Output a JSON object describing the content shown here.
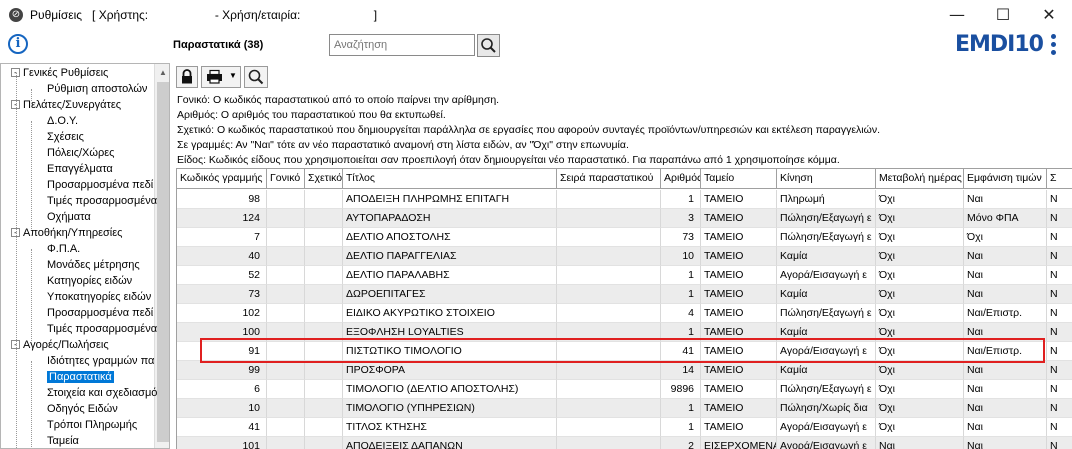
{
  "window": {
    "title": "Ρυθμίσεις   [ Χρήστης:                    - Χρήση/εταιρία:                      ]",
    "minimize_glyph": "—",
    "maximize_glyph": "☐",
    "close_glyph": "✕"
  },
  "header": {
    "page_title": "Παραστατικά (38)",
    "search_placeholder": "Αναζήτηση",
    "logo_prefix": "EMDI",
    "logo_suffix": "10"
  },
  "sidebar": {
    "items": [
      {
        "label": "Γενικές Ρυθμίσεις",
        "level": 0,
        "expander": "-"
      },
      {
        "label": "Ρύθμιση αποστολών",
        "level": 1
      },
      {
        "label": "Πελάτες/Συνεργάτες",
        "level": 0,
        "expander": "-"
      },
      {
        "label": "Δ.Ο.Υ.",
        "level": 1
      },
      {
        "label": "Σχέσεις",
        "level": 1
      },
      {
        "label": "Πόλεις/Χώρες",
        "level": 1
      },
      {
        "label": "Επαγγέλματα",
        "level": 1
      },
      {
        "label": "Προσαρμοσμένα πεδί",
        "level": 1
      },
      {
        "label": "Τιμές προσαρμοσμένα",
        "level": 1
      },
      {
        "label": "Οχήματα",
        "level": 1
      },
      {
        "label": "Αποθήκη/Υπηρεσίες",
        "level": 0,
        "expander": "-"
      },
      {
        "label": "Φ.Π.Α.",
        "level": 1
      },
      {
        "label": "Μονάδες μέτρησης",
        "level": 1
      },
      {
        "label": "Κατηγορίες ειδών",
        "level": 1
      },
      {
        "label": "Υποκατηγορίες ειδών",
        "level": 1
      },
      {
        "label": "Προσαρμοσμένα πεδί",
        "level": 1
      },
      {
        "label": "Τιμές προσαρμοσμένα",
        "level": 1
      },
      {
        "label": "Αγορές/Πωλήσεις",
        "level": 0,
        "expander": "-"
      },
      {
        "label": "Ιδιότητες γραμμών πα",
        "level": 1
      },
      {
        "label": "Παραστατικά",
        "level": 1,
        "selected": true
      },
      {
        "label": "Στοιχεία και σχεδιασμό",
        "level": 1
      },
      {
        "label": "Οδηγός Ειδών",
        "level": 1
      },
      {
        "label": "Τρόποι Πληρωμής",
        "level": 1
      },
      {
        "label": "Ταμεία",
        "level": 1
      }
    ]
  },
  "descriptions": [
    "Γονικό: Ο κωδικός παραστατικού από το οποίο παίρνει την αρίθμηση.",
    "Αριθμός: Ο αριθμός του παραστατικού που θα εκτυπωθεί.",
    "Σχετικό: Ο κωδικός παραστατικού που δημιουργείται παράλληλα σε εργασίες που αφορούν συνταγές προϊόντων/υπηρεσιών και εκτέλεση παραγγελιών.",
    "Σε γραμμές: Αν \"Ναι\" τότε αν νέο παραστατικό αναμονή στη λίστα ειδών, αν \"Όχι\" στην επωνυμία.",
    "Είδος: Κωδικός είδους που χρησιμοποιείται σαν προεπιλογή όταν δημιουργείται νέο παραστατικό. Για παραπάνω από 1 χρησιμοποίησε κόμμα."
  ],
  "grid": {
    "columns": [
      "Κωδικός γραμμής",
      "Γονικό",
      "Σχετικό",
      "Τίτλος",
      "Σειρά παραστατικού",
      "Αριθμός",
      "Ταμείο",
      "Κίνηση",
      "Μεταβολή ημέρας",
      "Εμφάνιση τιμών",
      "Σ"
    ],
    "rows": [
      [
        "98",
        "",
        "",
        "ΑΠΟΔΕΙΞΗ ΠΛΗΡΩΜΗΣ ΕΠΙΤΑΓΗ",
        "",
        "1",
        "ΤΑΜΕΙΟ",
        "Πληρωμή",
        "Όχι",
        "Ναι",
        "Ν"
      ],
      [
        "124",
        "",
        "",
        "ΑΥΤΟΠΑΡΑΔΟΣΗ",
        "",
        "3",
        "ΤΑΜΕΙΟ",
        "Πώληση/Εξαγωγή ε",
        "Όχι",
        "Μόνο ΦΠΑ",
        "Ν"
      ],
      [
        "7",
        "",
        "",
        "ΔΕΛΤΙΟ ΑΠΟΣΤΟΛΗΣ",
        "",
        "73",
        "ΤΑΜΕΙΟ",
        "Πώληση/Εξαγωγή ε",
        "Όχι",
        "Όχι",
        "Ν"
      ],
      [
        "40",
        "",
        "",
        "ΔΕΛΤΙΟ ΠΑΡΑΓΓΕΛΙΑΣ",
        "",
        "10",
        "ΤΑΜΕΙΟ",
        "Καμία",
        "Όχι",
        "Ναι",
        "Ν"
      ],
      [
        "52",
        "",
        "",
        "ΔΕΛΤΙΟ ΠΑΡΑΛΑΒΗΣ",
        "",
        "1",
        "ΤΑΜΕΙΟ",
        "Αγορά/Εισαγωγή ε",
        "Όχι",
        "Ναι",
        "Ν"
      ],
      [
        "73",
        "",
        "",
        "ΔΩΡΟΕΠΙΤΑΓΕΣ",
        "",
        "1",
        "ΤΑΜΕΙΟ",
        "Καμία",
        "Όχι",
        "Ναι",
        "Ν"
      ],
      [
        "102",
        "",
        "",
        "ΕΙΔΙΚΟ ΑΚΥΡΩΤΙΚΟ ΣΤΟΙΧΕΙΟ",
        "",
        "4",
        "ΤΑΜΕΙΟ",
        "Πώληση/Εξαγωγή ε",
        "Όχι",
        "Ναι/Επιστρ.",
        "Ν"
      ],
      [
        "100",
        "",
        "",
        "ΕΞΟΦΛΗΣΗ LOYALTIES",
        "",
        "1",
        "ΤΑΜΕΙΟ",
        "Καμία",
        "Όχι",
        "Ναι",
        "Ν"
      ],
      [
        "91",
        "",
        "",
        "ΠΙΣΤΩΤΙΚΟ ΤΙΜΟΛΟΓΙΟ",
        "",
        "41",
        "ΤΑΜΕΙΟ",
        "Αγορά/Εισαγωγή ε",
        "Όχι",
        "Ναι/Επιστρ.",
        "Ν"
      ],
      [
        "99",
        "",
        "",
        "ΠΡΟΣΦΟΡΑ",
        "",
        "14",
        "ΤΑΜΕΙΟ",
        "Καμία",
        "Όχι",
        "Ναι",
        "Ν"
      ],
      [
        "6",
        "",
        "",
        "ΤΙΜΟΛΟΓΙΟ (ΔΕΛΤΙΟ ΑΠΟΣΤΟΛΗΣ)",
        "",
        "9896",
        "ΤΑΜΕΙΟ",
        "Πώληση/Εξαγωγή ε",
        "Όχι",
        "Ναι",
        "Ν"
      ],
      [
        "10",
        "",
        "",
        "ΤΙΜΟΛΟΓΙΟ (ΥΠΗΡΕΣΙΩΝ)",
        "",
        "1",
        "ΤΑΜΕΙΟ",
        "Πώληση/Χωρίς δια",
        "Όχι",
        "Ναι",
        "Ν"
      ],
      [
        "41",
        "",
        "",
        "ΤΙΤΛΟΣ ΚΤΗΣΗΣ",
        "",
        "1",
        "ΤΑΜΕΙΟ",
        "Αγορά/Εισαγωγή ε",
        "Όχι",
        "Ναι",
        "Ν"
      ],
      [
        "101",
        "",
        "",
        "ΑΠΟΔΕΙΞΕΙΣ ΔΑΠΑΝΩΝ",
        "",
        "2",
        "ΕΙΣΕΡΧΟΜΕΝΑ",
        "Αγορά/Εισαγωγή ε",
        "Ναι",
        "Ναι",
        "Ν"
      ]
    ],
    "highlighted_row": "91"
  }
}
